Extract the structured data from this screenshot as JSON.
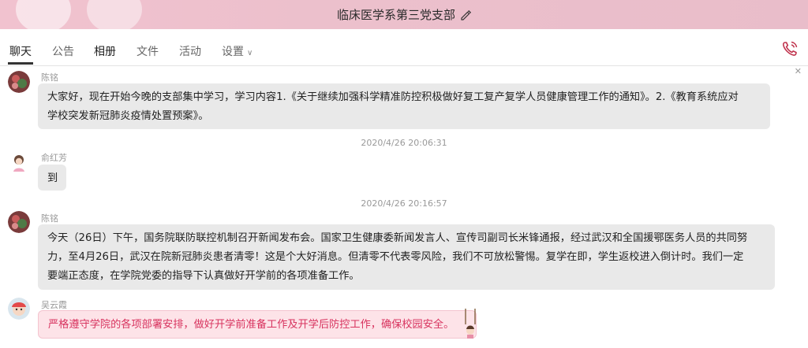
{
  "header": {
    "group_name": "临床医学系第三党支部"
  },
  "tabs": [
    {
      "label": "聊天"
    },
    {
      "label": "公告"
    },
    {
      "label": "相册"
    },
    {
      "label": "文件"
    },
    {
      "label": "活动"
    },
    {
      "label": "设置"
    }
  ],
  "messages": [
    {
      "sender": "陈铭",
      "text_line1": "大家好，现在开始今晚的支部集中学习，学习内容1.《关于继续加强科学精准防控积极做好复工复产复学人员健康管理工作的通知》。2.《教育系统应对",
      "text_line2": "学校突发新冠肺炎疫情处置预案》。"
    },
    {
      "sender": "俞红芳",
      "text": "到"
    },
    {
      "sender": "陈铭",
      "text_line1": "今天（26日）下午，国务院联防联控机制召开新闻发布会。国家卫生健康委新闻发言人、宣传司副司长米锋通报，经过武汉和全国援鄂医务人员的共同努",
      "text_line2": "力，至4月26日，武汉在院新冠肺炎患者清零！这是个大好消息。但清零不代表零风险，我们不可放松警惕。复学在即，学生返校进入倒计时。我们一定",
      "text_line3": "要端正态度，在学院党委的指导下认真做好开学前的各项准备工作。"
    },
    {
      "sender": "吴云霞",
      "text": "严格遵守学院的各项部署安排，做好开学前准备工作及开学后防控工作，确保校园安全。"
    }
  ],
  "timestamps": [
    "2020/4/26 20:06:31",
    "2020/4/26 20:16:57"
  ],
  "colors": {
    "header_bg": "#ecc0cc",
    "pink_bubble_text": "#d8345f",
    "pink_bubble_bg": "#fde3e8",
    "call_icon": "#c0334d"
  }
}
